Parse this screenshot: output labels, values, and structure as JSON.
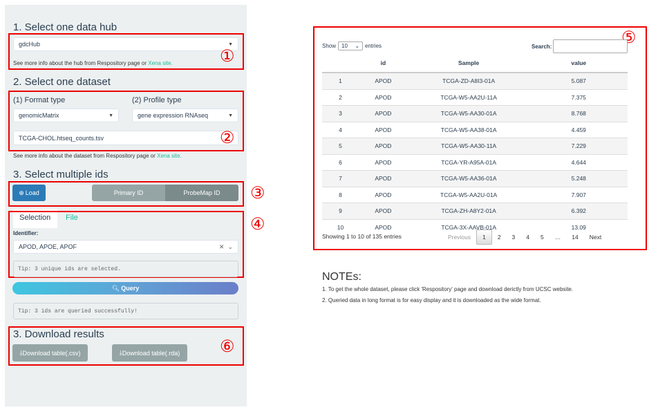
{
  "hub": {
    "heading": "1. Select one data hub",
    "selected": "gdcHub",
    "info": "See more info about the hub from Respository page or ",
    "link": "Xena site.",
    "marker": "①"
  },
  "dataset": {
    "heading": "2. Select one dataset",
    "format_label": "(1) Format type",
    "format_value": "genomicMatrix",
    "profile_label": "(2) Profile type",
    "profile_value": "gene expression RNAseq",
    "dataset_value": "TCGA-CHOL.htseq_counts.tsv",
    "info": "See more info about the dataset from Respository page or ",
    "link": "Xena site.",
    "marker": "②"
  },
  "ids": {
    "heading": "3. Select multiple ids",
    "load": "Load",
    "primary": "Primary ID",
    "probemap": "ProbeMap ID",
    "marker": "③"
  },
  "selection": {
    "tabs": [
      "Selection",
      "File"
    ],
    "identifier_label": "Identifier:",
    "identifier_value": "APOD, APOE, APOF",
    "tip": "Tip: 3 unique ids are selected.",
    "marker": "④"
  },
  "query": {
    "label": "Query",
    "tip": "Tip: 3 ids are queried successfully!"
  },
  "download": {
    "heading": "3. Download results",
    "csv": "Download table(.csv)",
    "rda": "Download table(.rda)",
    "marker": "⑥"
  },
  "table": {
    "show": "Show",
    "length": "10",
    "entries": "entries",
    "search_label": "Search:",
    "search_value": "",
    "marker": "⑤",
    "columns": [
      "",
      "id",
      "Sample",
      "value"
    ],
    "rows": [
      [
        "1",
        "APOD",
        "TCGA-ZD-A8I3-01A",
        "5.087"
      ],
      [
        "2",
        "APOD",
        "TCGA-W5-AA2U-11A",
        "7.375"
      ],
      [
        "3",
        "APOD",
        "TCGA-W5-AA30-01A",
        "8.768"
      ],
      [
        "4",
        "APOD",
        "TCGA-W5-AA38-01A",
        "4.459"
      ],
      [
        "5",
        "APOD",
        "TCGA-W5-AA30-11A",
        "7.229"
      ],
      [
        "6",
        "APOD",
        "TCGA-YR-A95A-01A",
        "4.644"
      ],
      [
        "7",
        "APOD",
        "TCGA-W5-AA36-01A",
        "5.248"
      ],
      [
        "8",
        "APOD",
        "TCGA-W5-AA2U-01A",
        "7.907"
      ],
      [
        "9",
        "APOD",
        "TCGA-ZH-A8Y2-01A",
        "6.392"
      ],
      [
        "10",
        "APOD",
        "TCGA-3X-AAVB-01A",
        "13.09"
      ]
    ],
    "footer": "Showing 1 to 10 of 135 entries",
    "pages": [
      "Previous",
      "1",
      "2",
      "3",
      "4",
      "5",
      "…",
      "14",
      "Next"
    ],
    "current_page": "1"
  },
  "notes": {
    "heading": "NOTEs:",
    "lines": [
      "1. To get the whole dataset, please click 'Respository' page and download derictly from UCSC website.",
      "2. Queried data in long format is for easy display and it is downloaded as the wide format."
    ]
  },
  "colors": {
    "accent": "#18bc9c",
    "primary": "#2c7bb6",
    "marker": "#ee0000"
  }
}
